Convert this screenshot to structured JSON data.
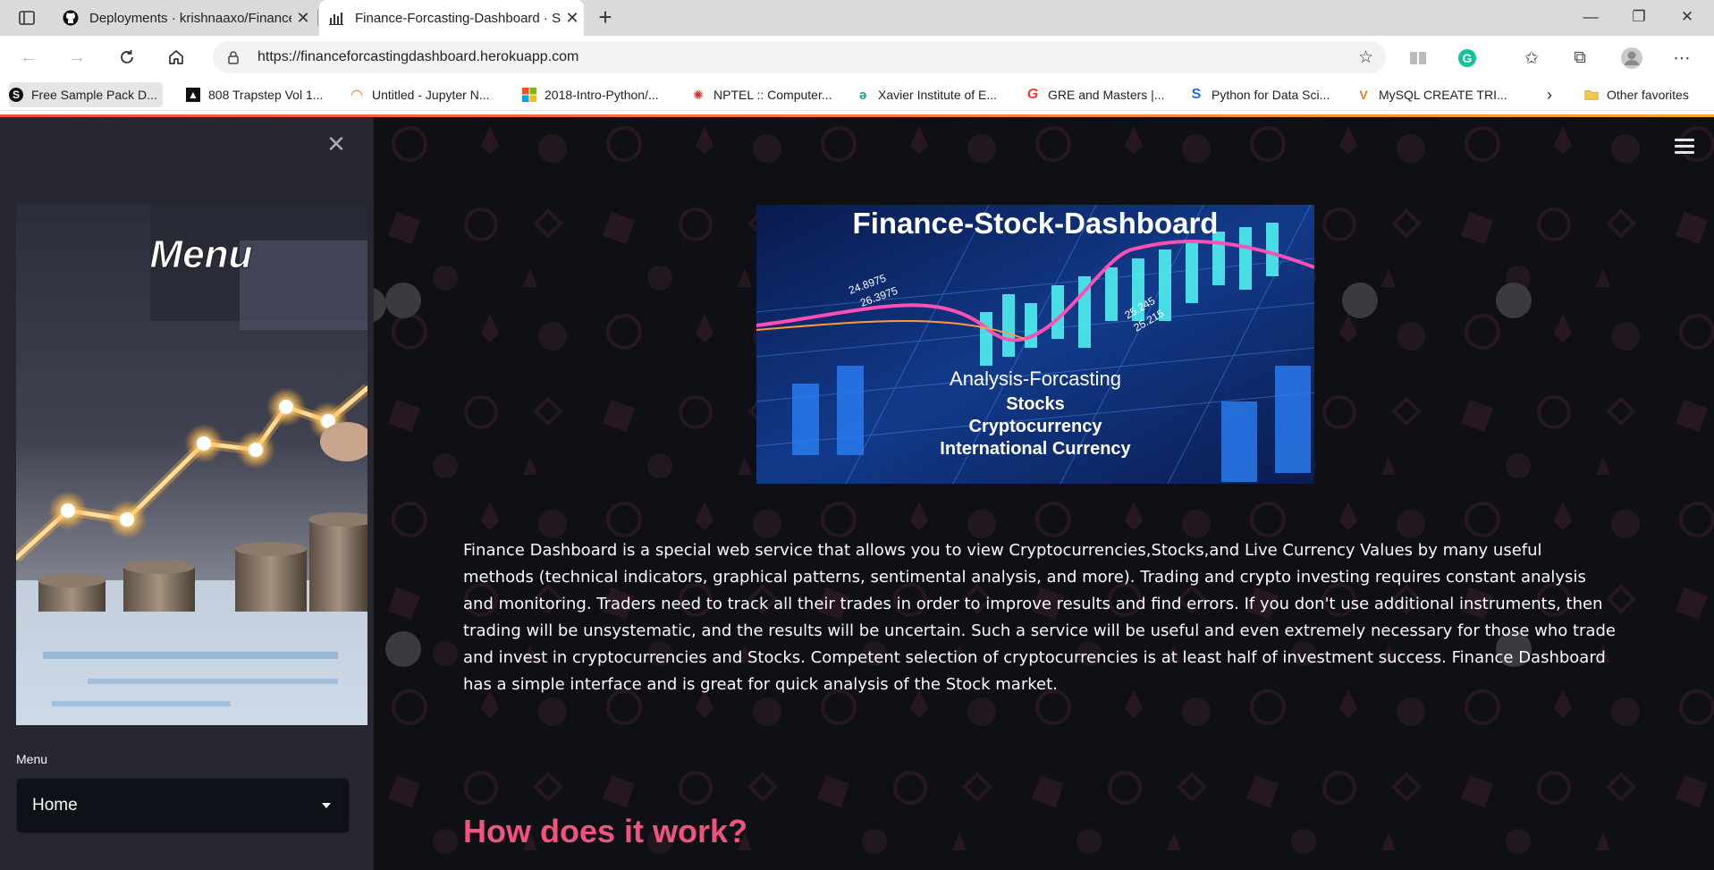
{
  "browser": {
    "tabs": [
      {
        "title": "Deployments · krishnaaxo/Finance-Forcasting",
        "active": false
      },
      {
        "title": "Finance-Forcasting-Dashboard · Streamlit",
        "active": true
      }
    ],
    "url": "https://financeforcastingdashboard.herokuapp.com",
    "bookmarks": [
      {
        "label": "Free Sample Pack D..."
      },
      {
        "label": "808 Trapstep Vol 1..."
      },
      {
        "label": "Untitled - Jupyter N..."
      },
      {
        "label": "2018-Intro-Python/..."
      },
      {
        "label": "NPTEL :: Computer..."
      },
      {
        "label": "Xavier Institute of E..."
      },
      {
        "label": "GRE and Masters |..."
      },
      {
        "label": "Python for Data Sci..."
      },
      {
        "label": "MySQL CREATE TRI..."
      }
    ],
    "other_favorites": "Other favorites",
    "grammarly_letter": "G"
  },
  "sidebar": {
    "image_text": "Menu",
    "menu_label": "Menu",
    "select_value": "Home"
  },
  "main": {
    "banner": {
      "title": "Finance-Stock-Dashboard",
      "subtitle": "Analysis-Forcasting",
      "line1": "Stocks",
      "line2": "Cryptocurrency",
      "line3": "International Currency",
      "num1": "24.8975",
      "num2": "26.3975",
      "num3": "25.245",
      "num4": "25.215"
    },
    "description": "Finance Dashboard is a special web service that allows you to view Cryptocurrencies,Stocks,and Live Currency Values by many useful methods (technical indicators, graphical patterns, sentimental analysis, and more). Trading and crypto investing requires constant analysis and monitoring. Traders need to track all their trades in order to improve results and find errors. If you don't use additional instruments, then trading will be unsystematic, and the results will be uncertain. Such a service will be useful and even extremely necessary for those who trade and invest in cryptocurrencies and Stocks. Competent selection of cryptocurrencies is at least half of investment success. Finance Dashboard has a simple interface and is great for quick analysis of the Stock market.",
    "section_heading": "How does it work?"
  },
  "colors": {
    "accent": "#f0547e",
    "sidebar_bg": "#262730",
    "main_bg": "#0f1016"
  }
}
